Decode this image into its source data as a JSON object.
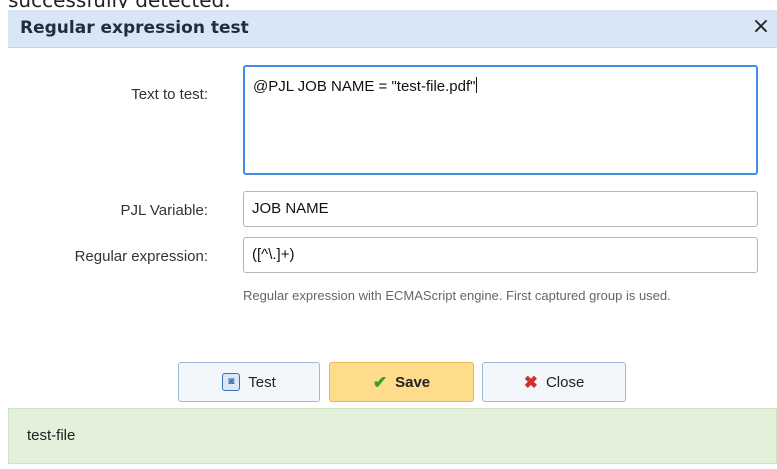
{
  "background_caption": "successfully detected.",
  "dialog": {
    "title": "Regular expression test",
    "close_glyph": "×"
  },
  "form": {
    "text_to_test_label": "Text to test:",
    "text_to_test_value": "@PJL JOB NAME = \"test-file.pdf\"",
    "pjl_variable_label": "PJL Variable:",
    "pjl_variable_value": "JOB NAME",
    "regex_label": "Regular expression:",
    "regex_value": "([^\\.]+)",
    "regex_hint": "Regular expression with ECMAScript engine. First captured group is used."
  },
  "buttons": {
    "test_label": "Test",
    "save_label": "Save",
    "close_label": "Close",
    "test_icon": "test-icon",
    "save_icon": "checkmark-icon",
    "close_icon": "x-icon"
  },
  "result": {
    "text": "test-file"
  },
  "colors": {
    "titlebar": "#d9e6f5",
    "save_button": "#ffdb8c",
    "result_background": "#e3f0da",
    "focus_border": "#3f8ee8"
  }
}
